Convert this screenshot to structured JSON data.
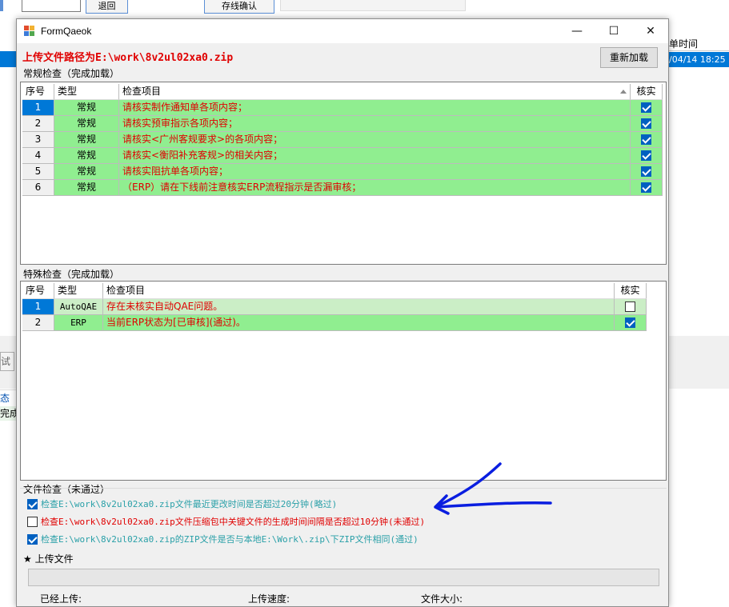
{
  "background": {
    "back_button": "退回",
    "online_confirm_button": "存线确认",
    "col_time": "单时间",
    "row_time": "/04/14 18:25",
    "side_btn": "试",
    "side_state": "态",
    "side_done": "完成/"
  },
  "window": {
    "title": "FormQaeok",
    "minimize": "—",
    "maximize": "☐",
    "close": "✕"
  },
  "upload_path_label": "上传文件路径为E:\\work\\8v2ul02xa0.zip",
  "reload_button": "重新加载",
  "routine": {
    "group_label": "常规检查（完成加载）",
    "headers": {
      "idx": "序号",
      "type": "类型",
      "item": "检查项目",
      "verified": "核实"
    },
    "rows": [
      {
        "idx": "1",
        "type": "常规",
        "item": "请核实制作通知单各项内容；",
        "checked": true
      },
      {
        "idx": "2",
        "type": "常规",
        "item": "请核实预审指示各项内容；",
        "checked": true
      },
      {
        "idx": "3",
        "type": "常规",
        "item": "请核实<广州客规要求>的各项内容；",
        "checked": true
      },
      {
        "idx": "4",
        "type": "常规",
        "item": "请核实<衡阳补充客规>的相关内容；",
        "checked": true
      },
      {
        "idx": "5",
        "type": "常规",
        "item": "请核实阻抗单各项内容；",
        "checked": true
      },
      {
        "idx": "6",
        "type": "常规",
        "item": "（ERP）请在下线前注意核实ERP流程指示是否漏审核；",
        "checked": true
      }
    ]
  },
  "special": {
    "group_label": "特殊检查（完成加载）",
    "headers": {
      "idx": "序号",
      "type": "类型",
      "item": "检查项目",
      "verified": "核实"
    },
    "rows": [
      {
        "idx": "1",
        "type": "AutoQAE",
        "item": "存在未核实自动QAE问题。",
        "checked": false
      },
      {
        "idx": "2",
        "type": "ERP",
        "item": "当前ERP状态为[已审核](通过)。",
        "checked": true
      }
    ]
  },
  "file_check": {
    "group_label": "文件检查（未通过）",
    "items": [
      {
        "text": "检查E:\\work\\8v2ul02xa0.zip文件最近更改时间是否超过20分钟(略过)",
        "checked": true,
        "status": "ok"
      },
      {
        "text": "检查E:\\work\\8v2ul02xa0.zip文件压缩包中关键文件的生成时间间隔是否超过10分钟(未通过)",
        "checked": false,
        "status": "fail"
      },
      {
        "text": "检查E:\\work\\8v2ul02xa0.zip的ZIP文件是否与本地E:\\Work\\.zip\\下ZIP文件相同(通过)",
        "checked": true,
        "status": "ok"
      }
    ]
  },
  "upload": {
    "group_label": "★ 上传文件",
    "uploaded_label": "已经上传:",
    "speed_label": "上传速度:",
    "size_label": "文件大小:"
  },
  "colors": {
    "row_green": "#90ee90",
    "row_light_green": "#cbeec6",
    "selection_blue": "#0078d7",
    "error_red": "#e00000",
    "ok_teal": "#2aa0a8",
    "annotation_arrow": "#0a1ee0"
  }
}
